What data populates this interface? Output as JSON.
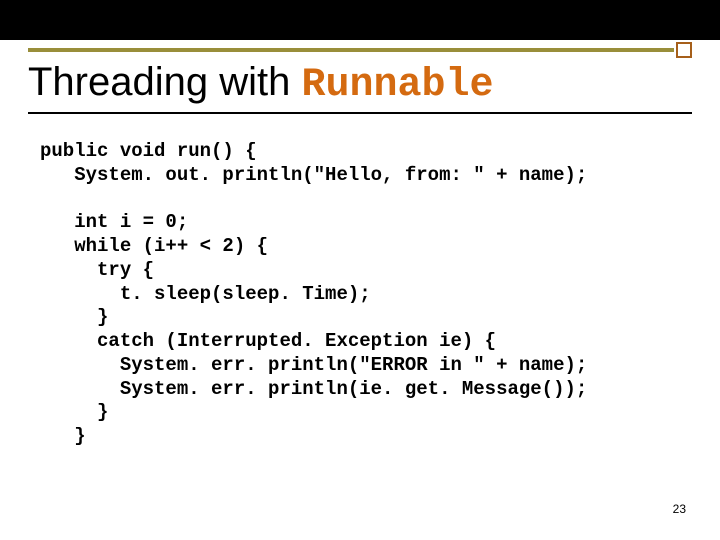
{
  "title": {
    "prefix": "Threading with ",
    "accent": "Runnable"
  },
  "code": "public void run() {\n   System. out. println(\"Hello, from: \" + name);\n\n   int i = 0;\n   while (i++ < 2) {\n     try {\n       t. sleep(sleep. Time);\n     }\n     catch (Interrupted. Exception ie) {\n       System. err. println(\"ERROR in \" + name);\n       System. err. println(ie. get. Message());\n     }\n   }",
  "page_number": "23"
}
